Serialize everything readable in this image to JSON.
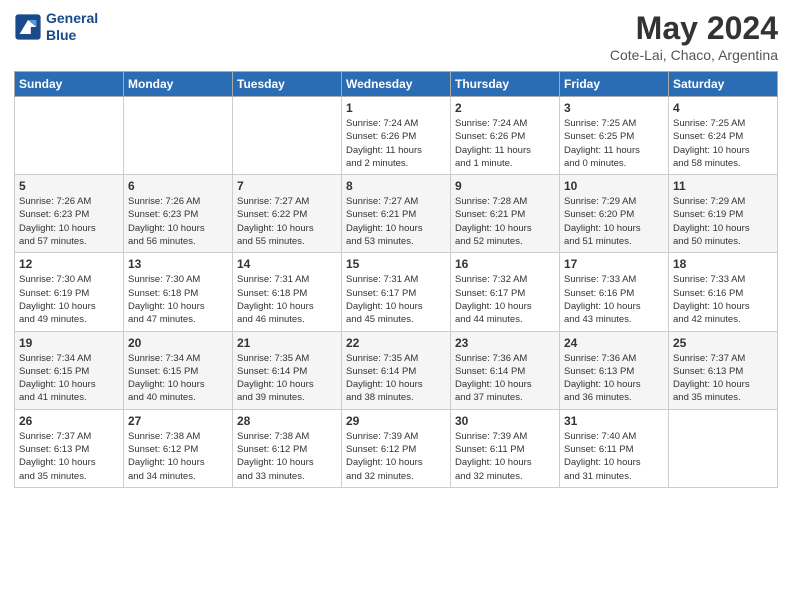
{
  "header": {
    "logo_line1": "General",
    "logo_line2": "Blue",
    "title": "May 2024",
    "subtitle": "Cote-Lai, Chaco, Argentina"
  },
  "days_of_week": [
    "Sunday",
    "Monday",
    "Tuesday",
    "Wednesday",
    "Thursday",
    "Friday",
    "Saturday"
  ],
  "weeks": [
    [
      {
        "day": "",
        "info": ""
      },
      {
        "day": "",
        "info": ""
      },
      {
        "day": "",
        "info": ""
      },
      {
        "day": "1",
        "info": "Sunrise: 7:24 AM\nSunset: 6:26 PM\nDaylight: 11 hours\nand 2 minutes."
      },
      {
        "day": "2",
        "info": "Sunrise: 7:24 AM\nSunset: 6:26 PM\nDaylight: 11 hours\nand 1 minute."
      },
      {
        "day": "3",
        "info": "Sunrise: 7:25 AM\nSunset: 6:25 PM\nDaylight: 11 hours\nand 0 minutes."
      },
      {
        "day": "4",
        "info": "Sunrise: 7:25 AM\nSunset: 6:24 PM\nDaylight: 10 hours\nand 58 minutes."
      }
    ],
    [
      {
        "day": "5",
        "info": "Sunrise: 7:26 AM\nSunset: 6:23 PM\nDaylight: 10 hours\nand 57 minutes."
      },
      {
        "day": "6",
        "info": "Sunrise: 7:26 AM\nSunset: 6:23 PM\nDaylight: 10 hours\nand 56 minutes."
      },
      {
        "day": "7",
        "info": "Sunrise: 7:27 AM\nSunset: 6:22 PM\nDaylight: 10 hours\nand 55 minutes."
      },
      {
        "day": "8",
        "info": "Sunrise: 7:27 AM\nSunset: 6:21 PM\nDaylight: 10 hours\nand 53 minutes."
      },
      {
        "day": "9",
        "info": "Sunrise: 7:28 AM\nSunset: 6:21 PM\nDaylight: 10 hours\nand 52 minutes."
      },
      {
        "day": "10",
        "info": "Sunrise: 7:29 AM\nSunset: 6:20 PM\nDaylight: 10 hours\nand 51 minutes."
      },
      {
        "day": "11",
        "info": "Sunrise: 7:29 AM\nSunset: 6:19 PM\nDaylight: 10 hours\nand 50 minutes."
      }
    ],
    [
      {
        "day": "12",
        "info": "Sunrise: 7:30 AM\nSunset: 6:19 PM\nDaylight: 10 hours\nand 49 minutes."
      },
      {
        "day": "13",
        "info": "Sunrise: 7:30 AM\nSunset: 6:18 PM\nDaylight: 10 hours\nand 47 minutes."
      },
      {
        "day": "14",
        "info": "Sunrise: 7:31 AM\nSunset: 6:18 PM\nDaylight: 10 hours\nand 46 minutes."
      },
      {
        "day": "15",
        "info": "Sunrise: 7:31 AM\nSunset: 6:17 PM\nDaylight: 10 hours\nand 45 minutes."
      },
      {
        "day": "16",
        "info": "Sunrise: 7:32 AM\nSunset: 6:17 PM\nDaylight: 10 hours\nand 44 minutes."
      },
      {
        "day": "17",
        "info": "Sunrise: 7:33 AM\nSunset: 6:16 PM\nDaylight: 10 hours\nand 43 minutes."
      },
      {
        "day": "18",
        "info": "Sunrise: 7:33 AM\nSunset: 6:16 PM\nDaylight: 10 hours\nand 42 minutes."
      }
    ],
    [
      {
        "day": "19",
        "info": "Sunrise: 7:34 AM\nSunset: 6:15 PM\nDaylight: 10 hours\nand 41 minutes."
      },
      {
        "day": "20",
        "info": "Sunrise: 7:34 AM\nSunset: 6:15 PM\nDaylight: 10 hours\nand 40 minutes."
      },
      {
        "day": "21",
        "info": "Sunrise: 7:35 AM\nSunset: 6:14 PM\nDaylight: 10 hours\nand 39 minutes."
      },
      {
        "day": "22",
        "info": "Sunrise: 7:35 AM\nSunset: 6:14 PM\nDaylight: 10 hours\nand 38 minutes."
      },
      {
        "day": "23",
        "info": "Sunrise: 7:36 AM\nSunset: 6:14 PM\nDaylight: 10 hours\nand 37 minutes."
      },
      {
        "day": "24",
        "info": "Sunrise: 7:36 AM\nSunset: 6:13 PM\nDaylight: 10 hours\nand 36 minutes."
      },
      {
        "day": "25",
        "info": "Sunrise: 7:37 AM\nSunset: 6:13 PM\nDaylight: 10 hours\nand 35 minutes."
      }
    ],
    [
      {
        "day": "26",
        "info": "Sunrise: 7:37 AM\nSunset: 6:13 PM\nDaylight: 10 hours\nand 35 minutes."
      },
      {
        "day": "27",
        "info": "Sunrise: 7:38 AM\nSunset: 6:12 PM\nDaylight: 10 hours\nand 34 minutes."
      },
      {
        "day": "28",
        "info": "Sunrise: 7:38 AM\nSunset: 6:12 PM\nDaylight: 10 hours\nand 33 minutes."
      },
      {
        "day": "29",
        "info": "Sunrise: 7:39 AM\nSunset: 6:12 PM\nDaylight: 10 hours\nand 32 minutes."
      },
      {
        "day": "30",
        "info": "Sunrise: 7:39 AM\nSunset: 6:11 PM\nDaylight: 10 hours\nand 32 minutes."
      },
      {
        "day": "31",
        "info": "Sunrise: 7:40 AM\nSunset: 6:11 PM\nDaylight: 10 hours\nand 31 minutes."
      },
      {
        "day": "",
        "info": ""
      }
    ]
  ]
}
